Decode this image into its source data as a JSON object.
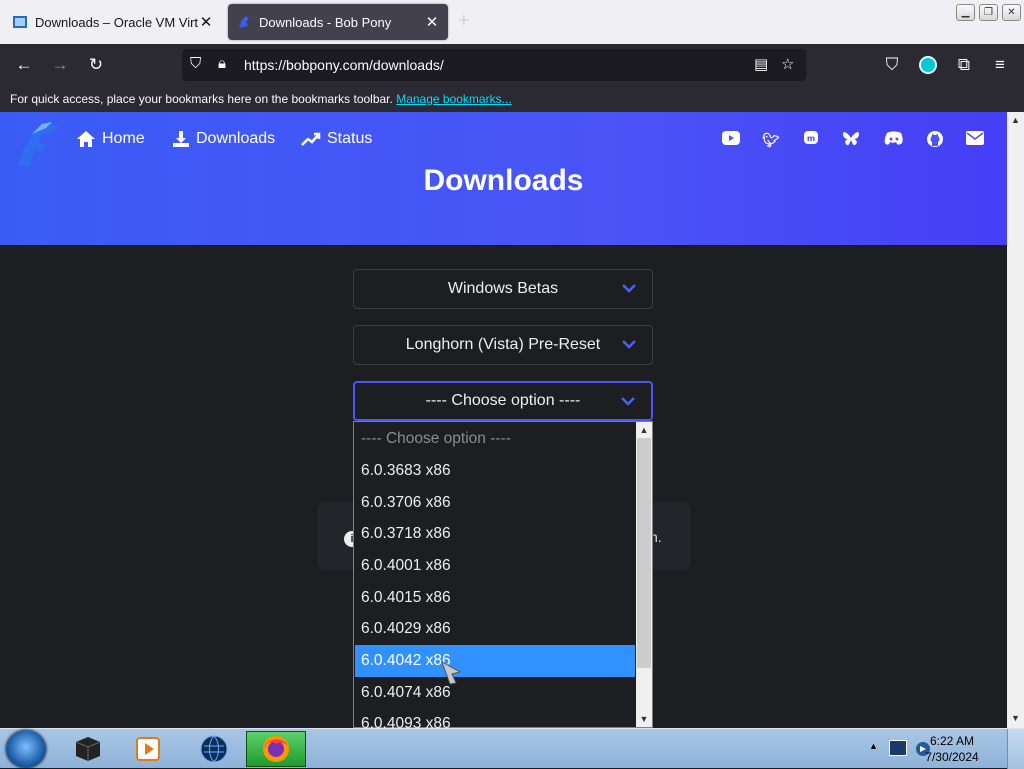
{
  "browser": {
    "tabs": [
      {
        "title": "Downloads – Oracle VM VirtualBox",
        "active": false
      },
      {
        "title": "Downloads - Bob Pony",
        "active": true
      }
    ],
    "url": "https://bobpony.com/downloads/",
    "bookmarks_hint": "For quick access, place your bookmarks here on the bookmarks toolbar.",
    "bookmarks_link": "Manage bookmarks..."
  },
  "site": {
    "nav": [
      {
        "label": "Home",
        "icon": "home-icon"
      },
      {
        "label": "Downloads",
        "icon": "download-icon"
      },
      {
        "label": "Status",
        "icon": "chart-line-icon"
      }
    ],
    "social": [
      "youtube-icon",
      "twitter-icon",
      "mastodon-icon",
      "bluesky-icon",
      "discord-icon",
      "github-icon",
      "mail-icon"
    ],
    "title": "Downloads"
  },
  "selects": {
    "category": "Windows Betas",
    "subcategory": "Longhorn (Vista) Pre-Reset",
    "build": "---- Choose option ----"
  },
  "dropdown": {
    "options": [
      "---- Choose option ----",
      "6.0.3683 x86",
      "6.0.3706 x86",
      "6.0.3718 x86",
      "6.0.4001 x86",
      "6.0.4015 x86",
      "6.0.4029 x86",
      "6.0.4042 x86",
      "6.0.4074 x86",
      "6.0.4093 x86"
    ],
    "highlighted": "6.0.4042 x86"
  },
  "info_fragment": "n.",
  "taskbar": {
    "time": "6:22 AM",
    "date": "7/30/2024"
  },
  "colors": {
    "accent": "#4a54f7",
    "highlight": "#3191ff",
    "link": "#00ddff"
  }
}
